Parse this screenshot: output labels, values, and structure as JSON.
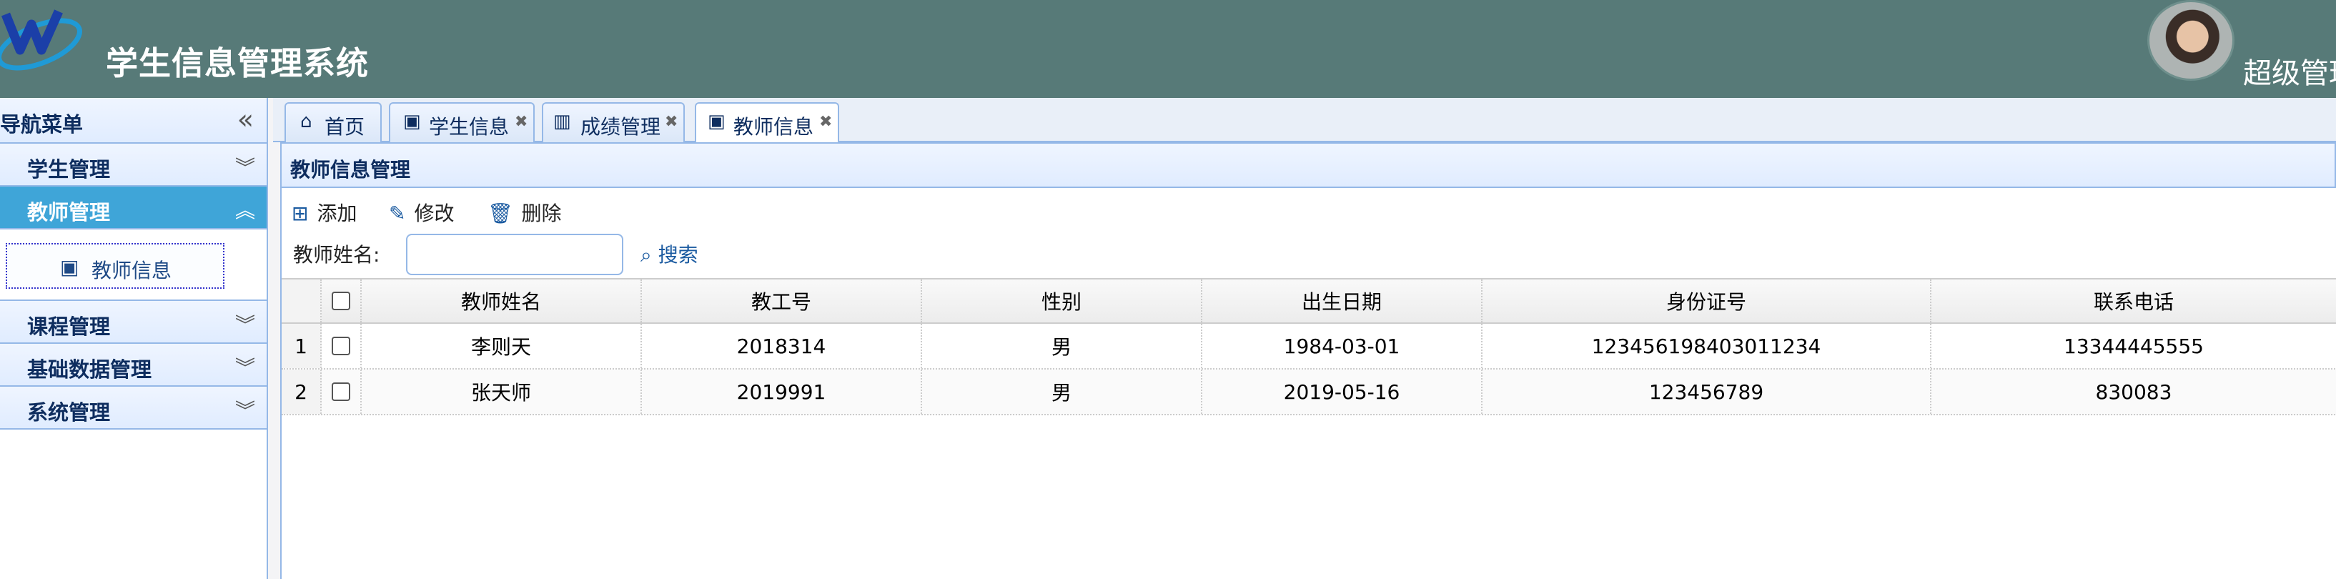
{
  "header": {
    "app_title": "学生信息管理系统",
    "user_name": "超级管理"
  },
  "sidebar": {
    "title": "导航菜单",
    "collapse_symbol": "«",
    "groups": [
      {
        "label": "学生管理",
        "chevron": "︾"
      },
      {
        "label": "教师管理",
        "chevron": "︽"
      },
      {
        "label": "课程管理",
        "chevron": "︾"
      },
      {
        "label": "基础数据管理",
        "chevron": "︾"
      },
      {
        "label": "系统管理",
        "chevron": "︾"
      }
    ],
    "active_sub_item": "教师信息"
  },
  "tabs": [
    {
      "label": "首页",
      "icon": "home-icon",
      "glyph": "⌂",
      "closable": false
    },
    {
      "label": "学生信息",
      "icon": "user-card-icon",
      "glyph": "▣",
      "closable": true
    },
    {
      "label": "成绩管理",
      "icon": "bar-chart-icon",
      "glyph": "▥",
      "closable": true
    },
    {
      "label": "教师信息",
      "icon": "user-card-icon",
      "glyph": "▣",
      "closable": true,
      "active": true
    }
  ],
  "panel": {
    "title": "教师信息管理",
    "toolbar": {
      "add_label": "添加",
      "edit_label": "修改",
      "delete_label": "删除"
    },
    "search": {
      "label": "教师姓名:",
      "value": "",
      "button_label": "搜索"
    }
  },
  "grid": {
    "columns": [
      "教师姓名",
      "教工号",
      "性别",
      "出生日期",
      "身份证号",
      "联系电话"
    ],
    "rows": [
      {
        "num": "1",
        "name": "李则天",
        "id": "2018314",
        "gender": "男",
        "birth": "1984-03-01",
        "id_card": "123456198403011234",
        "phone": "13344445555"
      },
      {
        "num": "2",
        "name": "张天师",
        "id": "2019991",
        "gender": "男",
        "birth": "2019-05-16",
        "id_card": "123456789",
        "phone": "830083"
      }
    ]
  },
  "colors": {
    "header_bg": "#577a78",
    "active_menu": "#3fa5d8",
    "border_blue": "#95b8e7"
  }
}
